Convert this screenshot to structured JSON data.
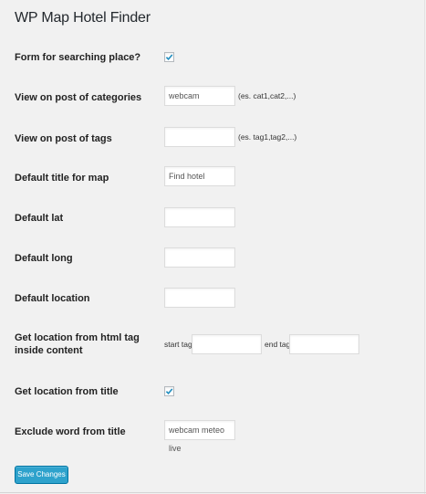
{
  "title": "WP Map Hotel Finder",
  "fields": {
    "form_search": {
      "label": "Form for searching place?",
      "checked": true
    },
    "view_categories": {
      "label": "View on post of categories",
      "value": "webcam",
      "hint": "(es. cat1,cat2,...)"
    },
    "view_tags": {
      "label": "View on post of tags",
      "value": "",
      "hint": "(es. tag1,tag2,...)"
    },
    "default_title": {
      "label": "Default title for map",
      "value": "Find hotel"
    },
    "default_lat": {
      "label": "Default lat",
      "value": ""
    },
    "default_long": {
      "label": "Default long",
      "value": ""
    },
    "default_location": {
      "label": "Default location",
      "value": ""
    },
    "location_html_tag": {
      "label_line1": "Get location from html tag",
      "label_line2": "inside content",
      "start_label": "start tag",
      "start_value": "",
      "end_label": "end tag",
      "end_value": ""
    },
    "location_title": {
      "label": "Get location from title",
      "checked": true
    },
    "exclude_word": {
      "label": "Exclude word from title",
      "value": "webcam meteo live"
    }
  },
  "save_button": "Save Changes",
  "colors": {
    "background": "#f1f1f1",
    "button": "#2ea2cc",
    "checkmark": "#1e8cbe"
  }
}
